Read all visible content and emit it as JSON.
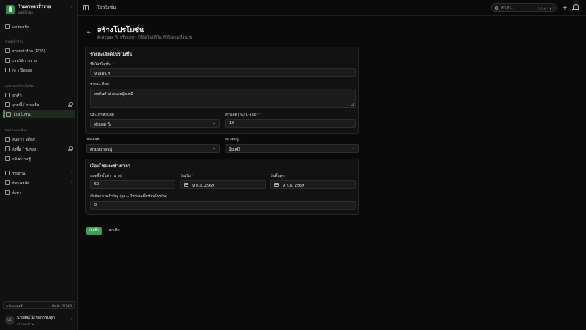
{
  "brand": {
    "name": "ร้านเกษตรร่ำรวย",
    "sub": "AgriShop"
  },
  "sidebar": {
    "top_item": "แดชบอร์ด",
    "sections": [
      {
        "title": "ขายหน้าร้าน",
        "items": [
          "ขายหน้าร้าน (POS)",
          "ประวัติการขาย",
          "กะ / ปิดยอด"
        ]
      },
      {
        "title": "ลูกค้าและโปรโมชั่น",
        "items": [
          "ลูกค้า",
          "ลูกหนี้ / ขายเชื่อ",
          "โปรโมชั่น"
        ]
      },
      {
        "title": "สินค้าและสต็อก",
        "items": [
          "สินค้า / สต็อก",
          "สั่งซื้อ / รับของ",
          "คลังความรู้"
        ]
      }
    ],
    "bottom_items": [
      "รายงาน",
      "ข้อมูลหลัก",
      "ตั้งค่า"
    ],
    "active_item": "โปรโมชั่น"
  },
  "plan": {
    "label": "แพ็กเกจฟรี",
    "usage": "สินค้า 1/300"
  },
  "user": {
    "initials": "UE",
    "name": "นายต้นไม้ รักการปลูก",
    "role": "เจ้าของร้าน"
  },
  "topbar": {
    "title": "โปรโมชั่น",
    "search_placeholder": "ค้นหา...",
    "shortcut": "Ctrl K"
  },
  "page": {
    "title": "สร้างโปรโมชั่น",
    "description": "ตั้งส่วนลด % หรือบาท - ใช้อัตโนมัติใน POS ตามเงื่อนไข"
  },
  "details_card": {
    "title": "รายละเอียดโปรโมชั่น",
    "name_label": "ชื่อโปรโมชั่น",
    "name_value": "9 เดือน 9",
    "desc_label": "รายละเอียด",
    "desc_value": "ลดสินค้าประเภทปุ๋ยเคมี",
    "type_label": "ประเภทส่วนลด",
    "type_value": "ส่วนลด %",
    "discount_label": "ส่วนลด (%) 1-100",
    "discount_value": "10"
  },
  "scope": {
    "scope_label": "ขอบเขต",
    "scope_value": "ตามหมวดหมู่",
    "category_label": "หมวดหมู่",
    "category_value": "ปุ๋ยเคมี"
  },
  "conditions_card": {
    "title": "เงื่อนไขและช่วงเวลา",
    "min_label": "ยอดซื้อขั้นต่ำ (บาท)",
    "min_value": "50",
    "start_label": "วันเริ่ม",
    "start_value": "9 ก.ย. 2569",
    "end_label": "วันสิ้นสุด",
    "end_value": "9 ก.ย. 2569",
    "priority_label": "ลำดับความสำคัญ (สูง = ใช้ก่อนเมื่อซ้อนโปรกัน)",
    "priority_value": "0"
  },
  "actions": {
    "save": "บันทึก",
    "cancel": "ยกเลิก"
  },
  "colors": {
    "accent": "#3c9d55",
    "required": "#e5484d",
    "background": "#0a0a0a"
  }
}
